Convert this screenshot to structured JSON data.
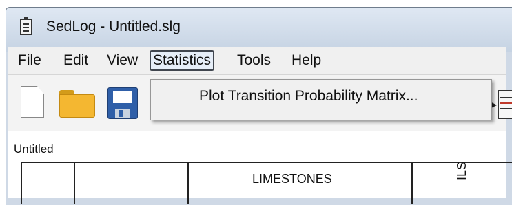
{
  "window": {
    "title": "SedLog - Untitled.slg",
    "app_icon": "document-lines-icon"
  },
  "menubar": {
    "items": [
      {
        "label": "File"
      },
      {
        "label": "Edit"
      },
      {
        "label": "View"
      },
      {
        "label": "Statistics",
        "active": true
      },
      {
        "label": "Tools"
      },
      {
        "label": "Help"
      }
    ]
  },
  "toolbar": {
    "icons": [
      "new-document-icon",
      "open-folder-icon",
      "save-disk-icon",
      "log-grid-icon"
    ]
  },
  "statistics_menu": {
    "items": [
      {
        "label": "Plot Transition Probability Matrix..."
      }
    ]
  },
  "document": {
    "tab_label": "Untitled",
    "column_header": "LIMESTONES",
    "rotated_label": "ILS"
  },
  "colors": {
    "titlebar": "#cfd9e6",
    "menu_bg": "#f0f0f0",
    "active_menu_border": "#40464f",
    "folder": "#f4b731",
    "save_disk": "#2f5fa8"
  }
}
